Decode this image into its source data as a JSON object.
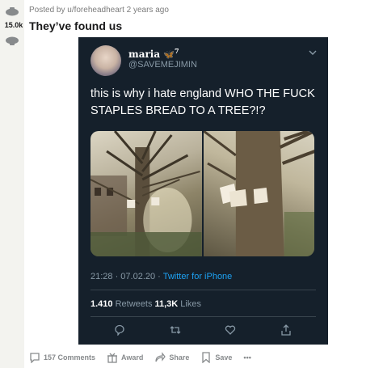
{
  "post": {
    "vote_count": "15.0k",
    "meta": "Posted by u/foreheadheart 2 years ago",
    "title": "They’ve found us"
  },
  "tweet": {
    "display_name": "maria",
    "name_superscript": "7",
    "handle": "@SAVEMEJIMIN",
    "text": "this is why i hate england WHO THE FUCK STAPLES BREAD TO A TREE?!?",
    "time": "21:28 · 07.02.20 · ",
    "source": "Twitter for iPhone",
    "retweets_count": "1.410",
    "retweets_label": " Retweets ",
    "likes_count": "11,3K",
    "likes_label": " Likes"
  },
  "actions": {
    "comments": "157 Comments",
    "award": "Award",
    "share": "Share",
    "save": "Save",
    "more": "•••"
  },
  "colors": {
    "tweet_bg": "#15202b",
    "link": "#1da1f2",
    "muted": "#8899a6"
  }
}
